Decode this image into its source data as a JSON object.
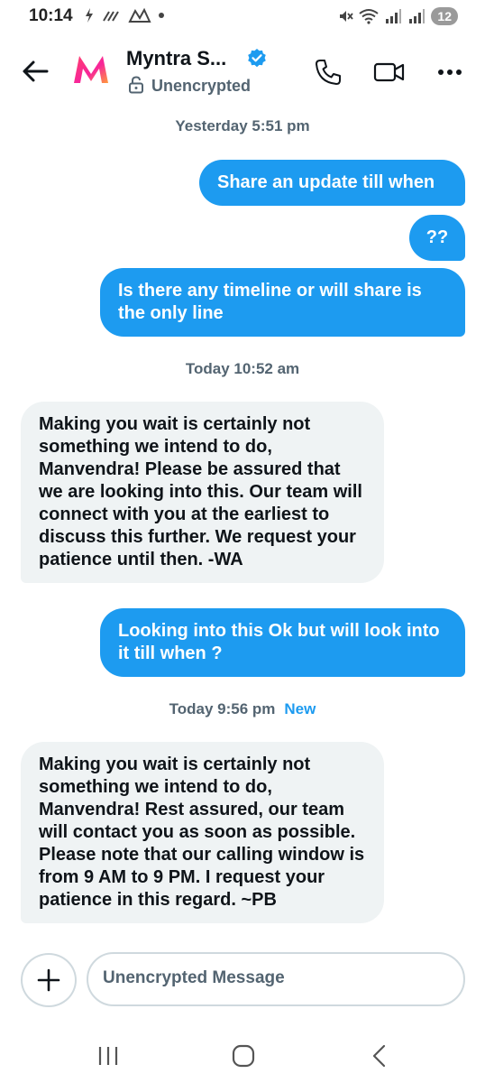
{
  "status_bar": {
    "time": "10:14",
    "battery": "12"
  },
  "header": {
    "contact_name": "Myntra S...",
    "encryption_label": "Unencrypted"
  },
  "messages": [
    {
      "type": "timestamp",
      "text": "Yesterday 5:51 pm"
    },
    {
      "type": "outgoing",
      "text": "Share an update till when"
    },
    {
      "type": "outgoing",
      "text": "??"
    },
    {
      "type": "outgoing",
      "text": "Is there any timeline or will share is the only line"
    },
    {
      "type": "timestamp",
      "text": "Today 10:52 am"
    },
    {
      "type": "incoming",
      "text": "Making you wait is certainly not something we intend to do, Manvendra! Please be assured that we are looking into this. Our team will connect with you at the earliest to discuss this further. We request your patience until then. -WA"
    },
    {
      "type": "outgoing",
      "text": "Looking into this Ok but will look into it till when ?"
    },
    {
      "type": "timestamp",
      "text": "Today 9:56 pm",
      "badge": "New"
    },
    {
      "type": "incoming",
      "text": "Making you wait is certainly not something we intend to do, Manvendra! Rest assured, our team will contact you as soon as possible. Please note that our calling window is from 9 AM to 9 PM. I request your patience in this regard. ~PB"
    }
  ],
  "composer": {
    "placeholder": "Unencrypted Message"
  },
  "icons": {
    "back": "arrow-left-icon",
    "avatar": "myntra-logo",
    "verified": "verified-badge-icon",
    "lock": "lock-icon",
    "call": "phone-icon",
    "video": "video-camera-icon",
    "more": "more-dots-icon",
    "add": "plus-icon"
  },
  "colors": {
    "outgoing_bubble": "#1d9bf0",
    "incoming_bubble": "#eff3f4",
    "accent": "#1d9bf0",
    "secondary_text": "#536471"
  }
}
